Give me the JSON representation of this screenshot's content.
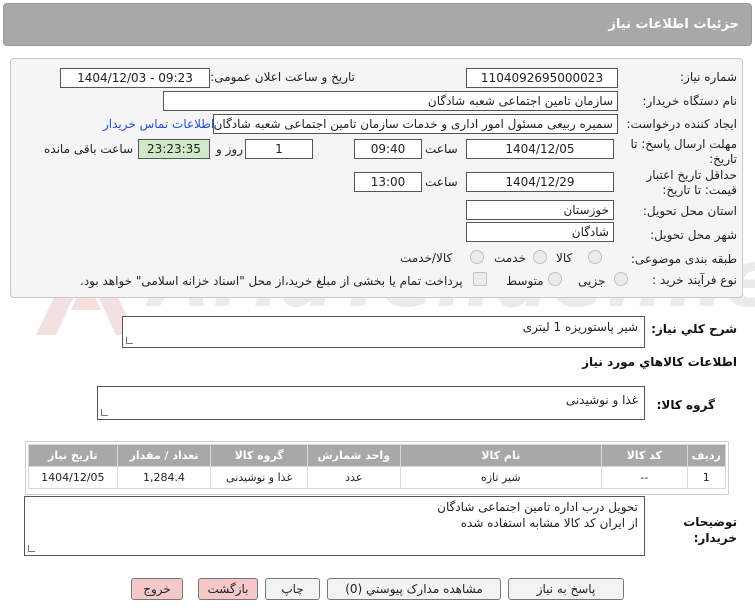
{
  "header": {
    "title": "جزئیات اطلاعات نیاز"
  },
  "form": {
    "need_number_label": "شماره نیاز:",
    "need_number_value": "1104092695000023",
    "announce_label": "تاریخ و ساعت اعلان عمومی:",
    "announce_value": "1404/12/03 - 09:23",
    "buyer_org_label": "نام دستگاه خریدار:",
    "buyer_org_value": "سازمان تامین اجتماعی شعبه شادگان",
    "requester_label": "ایجاد کننده درخواست:",
    "requester_value": "سمیره ربیعی مسئول امور اداری و خدمات سازمان تامین اجتماعی شعبه شادگان",
    "contact_link": "اطلاعات تماس خریدار",
    "reply_deadline_label": "مهلت ارسال پاسخ: تا تاریخ:",
    "reply_date": "1404/12/05",
    "time_label": "ساعت",
    "reply_time": "09:40",
    "days_value": "1",
    "days_label": "روز و",
    "remaining_value": "23:23:35",
    "remaining_label": "ساعت باقی مانده",
    "validity_label": "حداقل تاریخ اعتبار قیمت: تا تاریخ:",
    "validity_date": "1404/12/29",
    "validity_time_label": "ساعت",
    "validity_time": "13:00",
    "province_label": "استان محل تحویل:",
    "province_value": "خوزستان",
    "city_label": "شهر محل تحویل:",
    "city_value": "شادگان",
    "category_label": "طبقه بندی موضوعی:",
    "category_options": [
      "کالا",
      "خدمت",
      "کالا/خدمت"
    ],
    "purchase_type_label": "نوع فرآیند خرید :",
    "purchase_options": [
      "جزیی",
      "متوسط"
    ],
    "payment_note": "پرداخت تمام یا بخشی از مبلغ خرید،از محل \"اسناد خزانه اسلامی\" خواهد بود."
  },
  "watermark": "AriaTender.neT",
  "summary": {
    "label": "شرح کلي نياز:",
    "value": "شیر پاستوریزه 1 لیتری"
  },
  "goods_info": {
    "title": "اطلاعات كالاهاي مورد نياز",
    "group_label": "گروه کالا:",
    "group_value": "غذا و نوشیدنی"
  },
  "table": {
    "headers": [
      "ردیف",
      "کد کالا",
      "نام کالا",
      "واحد شمارش",
      "گروه کالا",
      "تعداد / مقدار",
      "تاریخ نیاز"
    ],
    "rows": [
      [
        "1",
        "--",
        "شیر تازه",
        "عدد",
        "غذا و نوشیدنی",
        "1,284.4",
        "1404/12/05"
      ]
    ]
  },
  "notes": {
    "label": "توضیحات خریدار:",
    "line1": "تحویل درب اداره تامین اجتماعی شادگان",
    "line2": "از ایران کد کالا مشابه استفاده شده"
  },
  "buttons": {
    "reply": "پاسخ به نیاز",
    "attachments": "مشاهده مدارک پیوستي (0)",
    "print": "چاپ",
    "back": "بازگشت",
    "exit": "خروج"
  }
}
